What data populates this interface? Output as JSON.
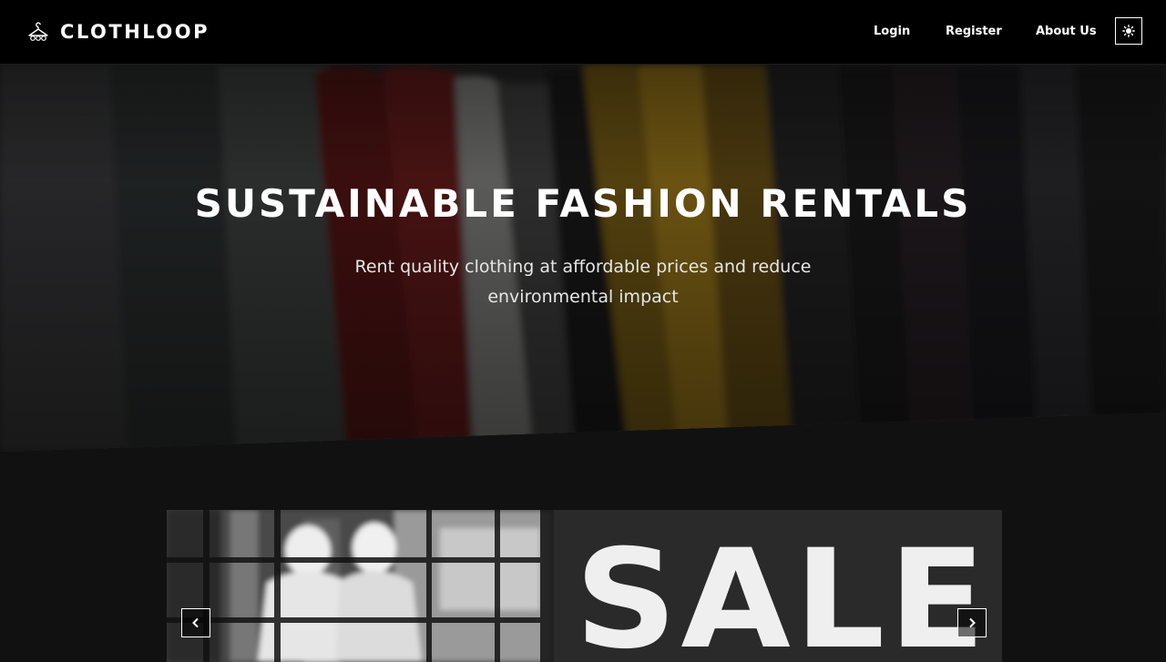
{
  "nav": {
    "brand": "CLOTHLOOP",
    "brand_icon": "hanger-icon",
    "links": [
      "Login",
      "Register",
      "About Us"
    ],
    "theme_toggle_icon": "sun-icon"
  },
  "hero": {
    "title": "SUSTAINABLE FASHION RENTALS",
    "subtitle": "Rent quality clothing at affordable prices and reduce environmental impact"
  },
  "carousel": {
    "slide_text": "SALE",
    "prev_icon": "chevron-left-icon",
    "next_icon": "chevron-right-icon"
  },
  "colors": {
    "background": "#111111",
    "nav_background": "#000000",
    "text": "#ffffff"
  }
}
